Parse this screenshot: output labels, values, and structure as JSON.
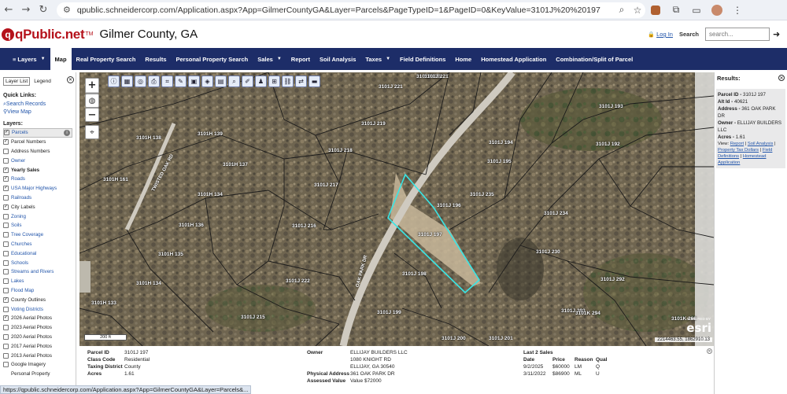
{
  "browser": {
    "url": "qpublic.schneidercorp.com/Application.aspx?App=GilmerCountyGA&Layer=Parcels&PageTypeID=1&PageID=0&KeyValue=3101J%20%20197",
    "status_url": "https://qpublic.schneidercorp.com/Application.aspx?App=GilmerCountyGA&Layer=Parcels&..."
  },
  "header": {
    "brand": "qPublic.net",
    "tm": "TM",
    "county": "Gilmer County, GA",
    "login": "Log In",
    "search_label": "Search",
    "search_placeholder": "search..."
  },
  "nav": [
    {
      "label": "Layers",
      "caret": true
    },
    {
      "label": "Map",
      "active": true
    },
    {
      "label": "Real Property Search"
    },
    {
      "label": "Results"
    },
    {
      "label": "Personal Property Search"
    },
    {
      "label": "Sales",
      "caret": true
    },
    {
      "label": "Report"
    },
    {
      "label": "Soil Analysis"
    },
    {
      "label": "Taxes",
      "caret": true
    },
    {
      "label": "Field Definitions"
    },
    {
      "label": "Home"
    },
    {
      "label": "Homestead Application"
    },
    {
      "label": "Combination/Split of Parcel"
    }
  ],
  "left_panel": {
    "tab_layer_list": "Layer List",
    "tab_legend": "Legend",
    "quick_links_title": "Quick Links:",
    "quick_links": [
      "Search Records",
      "View Map"
    ],
    "layers_title": "Layers:",
    "layers": [
      {
        "label": "Parcels",
        "checked": true,
        "selected": true,
        "link": true,
        "info": true
      },
      {
        "label": "Parcel Numbers",
        "checked": true
      },
      {
        "label": "Address Numbers",
        "checked": false
      },
      {
        "label": "Owner",
        "checked": false,
        "link": true
      },
      {
        "label": "Yearly Sales",
        "checked": true,
        "bold": true
      },
      {
        "label": "Roads",
        "checked": true,
        "link": true
      },
      {
        "label": "USA Major Highways",
        "checked": true,
        "link": true
      },
      {
        "label": "Railroads",
        "checked": false,
        "link": true
      },
      {
        "label": "City Labels",
        "checked": true
      },
      {
        "label": "Zoning",
        "checked": false,
        "link": true
      },
      {
        "label": "Soils",
        "checked": false,
        "link": true
      },
      {
        "label": "Tree Coverage",
        "checked": false,
        "link": true
      },
      {
        "label": "Churches",
        "checked": false,
        "link": true
      },
      {
        "label": "Educational",
        "checked": false,
        "link": true
      },
      {
        "label": "Schools",
        "checked": false,
        "link": true
      },
      {
        "label": "Streams and Rivers",
        "checked": false,
        "link": true
      },
      {
        "label": "Lakes",
        "checked": false,
        "link": true
      },
      {
        "label": "Flood Map",
        "checked": false,
        "link": true
      },
      {
        "label": "County Outlines",
        "checked": true
      },
      {
        "label": "Voting Districts",
        "checked": false,
        "link": true
      },
      {
        "label": "2026 Aerial Photos",
        "checked": true
      },
      {
        "label": "2023 Aerial Photos",
        "checked": false
      },
      {
        "label": "2020 Aerial Photos",
        "checked": false
      },
      {
        "label": "2017 Aerial Photos",
        "checked": false
      },
      {
        "label": "2013 Aerial Photos",
        "checked": false
      },
      {
        "label": "Google Imagery",
        "checked": false
      },
      {
        "label": "Personal Property",
        "indent": true
      }
    ]
  },
  "map": {
    "scale": "200 ft",
    "coords": "2214463.55, 1862910.13",
    "esri_powered": "POWERED BY",
    "esri": "esri",
    "road_labels": [
      "TWISTED OAK RD",
      "OAK PARK DR"
    ],
    "parcel_labels": [
      "3101J 220",
      "3101H 138",
      "3101H 137",
      "3101H 161",
      "3101H 139",
      "3101H 134",
      "3101H 136",
      "3101H 135",
      "3101H 134",
      "3101H 133",
      "3101J 215",
      "3101J 216",
      "3101J 217",
      "3101J 218",
      "3101J 219",
      "3101J 221",
      "3101J 222",
      "3101J 221",
      "3101J 194",
      "3101J 195",
      "3101J 196",
      "3101J 197",
      "3101J 198",
      "3101J 199",
      "3101J 200",
      "3101J 201",
      "3101J 234",
      "3101J 235",
      "3101J 193",
      "3101J 192",
      "3101J 230",
      "3101J 293",
      "3101J 292",
      "3101K 294",
      "3101K 268"
    ],
    "highlight_color": "#38e6e6",
    "parcel_line_color": "#1a1a1a"
  },
  "results": {
    "title": "Results:",
    "parcel_id_label": "Parcel ID -",
    "parcel_id": "3101J 197",
    "alt_id_label": "Alt Id -",
    "alt_id": "40621",
    "address_label": "Address -",
    "address": "361 OAK PARK DR",
    "owner_label": "Owner -",
    "owner": "ELLIJAY BUILDERS LLC",
    "acres_label": "Acres -",
    "acres": "1.61",
    "view_label": "View:",
    "links": [
      "Report",
      "Soil Analysis",
      "Property Tax Dollars",
      "Field Definitions",
      "Homestead Application"
    ]
  },
  "detail": {
    "parcel_id_label": "Parcel ID",
    "parcel_id": "3101J 197",
    "class_code_label": "Class Code",
    "class_code": "Residential",
    "taxing_district_label": "Taxing District",
    "taxing_district": "County",
    "acres_label": "Acres",
    "acres": "1.61",
    "owner_label": "Owner",
    "owner_lines": [
      "ELLIJAY BUILDERS LLC",
      "1080 KNIGHT RD",
      "ELLIJAY, GA 30540"
    ],
    "physical_address_label": "Physical Address",
    "physical_address": "361 OAK PARK DR",
    "assessed_value_label": "Assessed Value",
    "assessed_value": "Value $72000",
    "sales_title": "Last 2 Sales",
    "sales_headers": [
      "Date",
      "Price",
      "Reason",
      "Qual"
    ],
    "sales": [
      [
        "9/2/2025",
        "$60000",
        "LM",
        "Q"
      ],
      [
        "3/11/2022",
        "$86900",
        "ML",
        "U"
      ]
    ]
  }
}
